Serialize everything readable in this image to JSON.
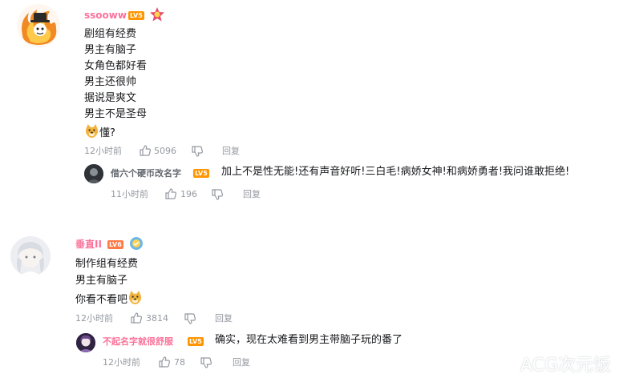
{
  "comments": [
    {
      "username": "ssooww",
      "level": "LV5",
      "lines": [
        "剧组有经费",
        "男主有脑子",
        "女角色都好看",
        "男主还很帅",
        "据说是爽文",
        "男主不是圣母"
      ],
      "last_line_text": "懂?",
      "time": "12小时前",
      "likes": "5096",
      "reply_label": "回复",
      "reply": {
        "username": "借六个硬币改名字",
        "level": "LV5",
        "text": "加上不是性无能!还有声音好听!三白毛!病娇女神!和病娇勇者!我问谁敢拒绝!",
        "time": "11小时前",
        "likes": "196",
        "reply_label": "回复"
      }
    },
    {
      "username": "垂直II",
      "level": "LV6",
      "lines": [
        "制作组有经费",
        "男主有脑子"
      ],
      "last_line_text": "你看不看吧",
      "time": "12小时前",
      "likes": "3814",
      "reply_label": "回复",
      "reply": {
        "username": "不起名字就很舒服",
        "level": "LV5",
        "text": "确实，现在太难看到男主带脑子玩的番了",
        "time": "12小时前",
        "likes": "78",
        "reply_label": "回复"
      }
    }
  ],
  "watermark": "ACG次元饭",
  "colors": {
    "vip_name": "#fb7299",
    "normal_name": "#61666d",
    "meta": "#9499a0",
    "lv5": "#ff9500",
    "lv6": "#ff3b3b"
  }
}
